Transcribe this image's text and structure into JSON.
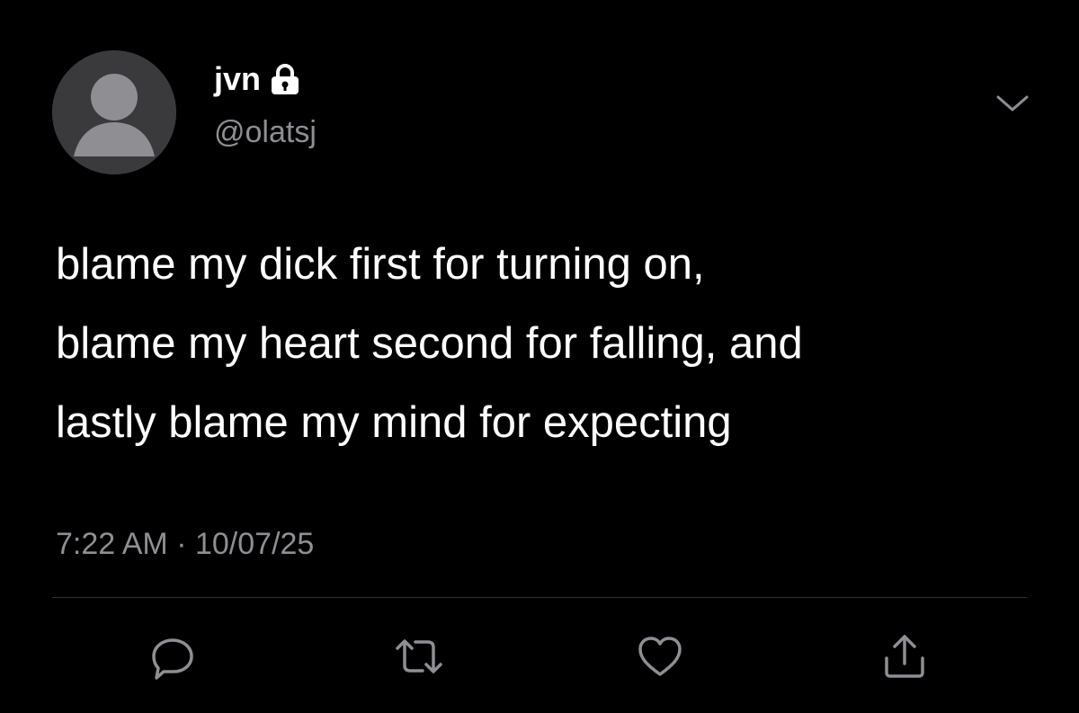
{
  "author": {
    "display_name": "jvn",
    "handle": "@olatsj",
    "avatar_icon": "default-avatar-icon",
    "protected_icon": "lock-icon"
  },
  "tweet": {
    "lines": [
      "blame my dick first for turning on,",
      "blame my heart second for falling, and",
      "lastly blame my mind for expecting"
    ],
    "time": "7:22 AM",
    "separator": "·",
    "date": "10/07/25"
  },
  "actions": {
    "reply_icon": "reply-icon",
    "retweet_icon": "retweet-icon",
    "like_icon": "heart-icon",
    "share_icon": "share-icon"
  },
  "colors": {
    "background": "#000000",
    "text_primary": "#ffffff",
    "text_secondary": "#8e8e93",
    "divider": "#2f2f32",
    "avatar_bg": "#3a3a3c",
    "avatar_fg": "#8e8e93"
  }
}
